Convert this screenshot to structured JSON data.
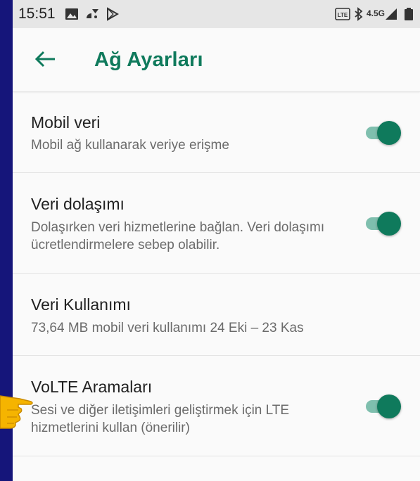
{
  "status_bar": {
    "time": "15:51",
    "left_icons": [
      "image-icon",
      "wifi-calling-icon",
      "play-store-icon"
    ],
    "right_icons": [
      "volte-icon",
      "bluetooth-icon",
      "network-4g-icon",
      "signal-icon",
      "battery-icon"
    ],
    "network_label": "4.5G"
  },
  "app_bar": {
    "title": "Ağ Ayarları",
    "back_icon": "arrow-back-icon",
    "accent": "#0f7a5c"
  },
  "settings": [
    {
      "title": "Mobil veri",
      "subtitle": "Mobil ağ kullanarak veriye erişme",
      "toggle": "on"
    },
    {
      "title": "Veri dolaşımı",
      "subtitle": "Dolaşırken veri hizmetlerine bağlan. Veri dolaşımı ücretlendirmelere sebep olabilir.",
      "toggle": "on"
    },
    {
      "title": "Veri Kullanımı",
      "subtitle": "73,64 MB mobil veri kullanımı 24 Eki – 23 Kas"
    },
    {
      "title": "VoLTE Aramaları",
      "subtitle": "Sesi ve diğer iletişimleri geliştirmek için LTE hizmetlerini kullan (önerilir)",
      "toggle": "on"
    }
  ],
  "colors": {
    "switch_on_thumb": "#0f7a5c",
    "switch_on_track": "#7fbfae",
    "pointer": "#f5b400"
  }
}
